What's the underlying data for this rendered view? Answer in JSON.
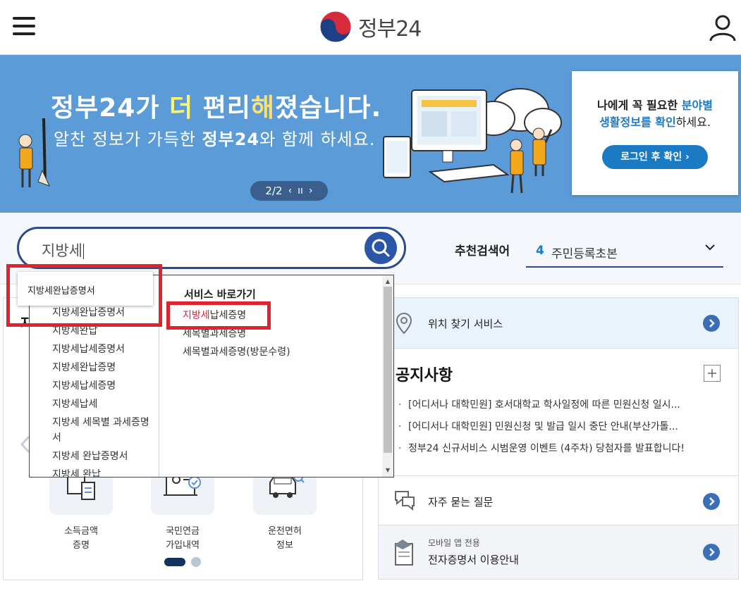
{
  "header": {
    "logo_text": "정부24"
  },
  "banner": {
    "title_part1": "정부24가 ",
    "title_hl1": "더",
    "title_part2": " 편리",
    "title_hl2": "해",
    "title_part3": "졌습니다.",
    "sub_part1": "알찬 정보가 가득한 ",
    "sub_bold": "정부24",
    "sub_part2": "와 함께 하세요.",
    "pager_text": "2/2",
    "login_card": {
      "line1_a": "나에게 꼭 필요한 ",
      "line1_b": "분야별",
      "line2_a": "생활정보를 확인",
      "line2_b": "하세요.",
      "button": "로그인 후 확인 ›"
    }
  },
  "search": {
    "value": "지방세",
    "recommend_label": "추천검색어",
    "recommend_rank": "4",
    "recommend_term": "주민등록초본"
  },
  "autocomplete": {
    "tooltip": "지방세완납증명서",
    "suggestions": [
      "지방세완납증명서",
      "지방세완납",
      "지방세납세증명서",
      "지방세완납증명",
      "지방세납세증명",
      "지방세납세",
      "지방세 세목별 과세증명서",
      "지방세 완납증명서",
      "지방세 완납"
    ],
    "services_header": "서비스 바로가기",
    "services": [
      {
        "kw": "지방세",
        "rest": "납세증명"
      },
      {
        "kw": "",
        "rest": "세목별과세증명"
      },
      {
        "kw": "",
        "rest": "세목별과세증명(방문수령)"
      }
    ]
  },
  "left_panel": {
    "title_fragment": "자",
    "services": [
      {
        "label": "소득금액\n증명"
      },
      {
        "label": "국민연금\n가입내역"
      },
      {
        "label": "운전면허\n정보"
      }
    ]
  },
  "right_panel": {
    "location_service": "위치 찾기 서비스",
    "notice_title": "공지사항",
    "notices": [
      "[어디서나 대학민원] 호서대학교 학사일정에 따른 민원신청 일시...",
      "[어디서나 대학민원] 민원신청 및 발급 일시 중단 안내(부산가톨...",
      "정부24 신규서비스 시범운영 이벤트 (4주차) 당첨자를 발표합니다!"
    ],
    "faq": "자주 묻는 질문",
    "cert_small": "모바일 앱 전용",
    "cert_main": "전자증명서 이용안내"
  },
  "colors": {
    "banner_bg": "#5b9bd8",
    "brand_navy": "#2b4b8c",
    "accent_blue": "#1a7ac4",
    "highlight_red": "#e0242e",
    "keyword_red": "#d6263b"
  }
}
